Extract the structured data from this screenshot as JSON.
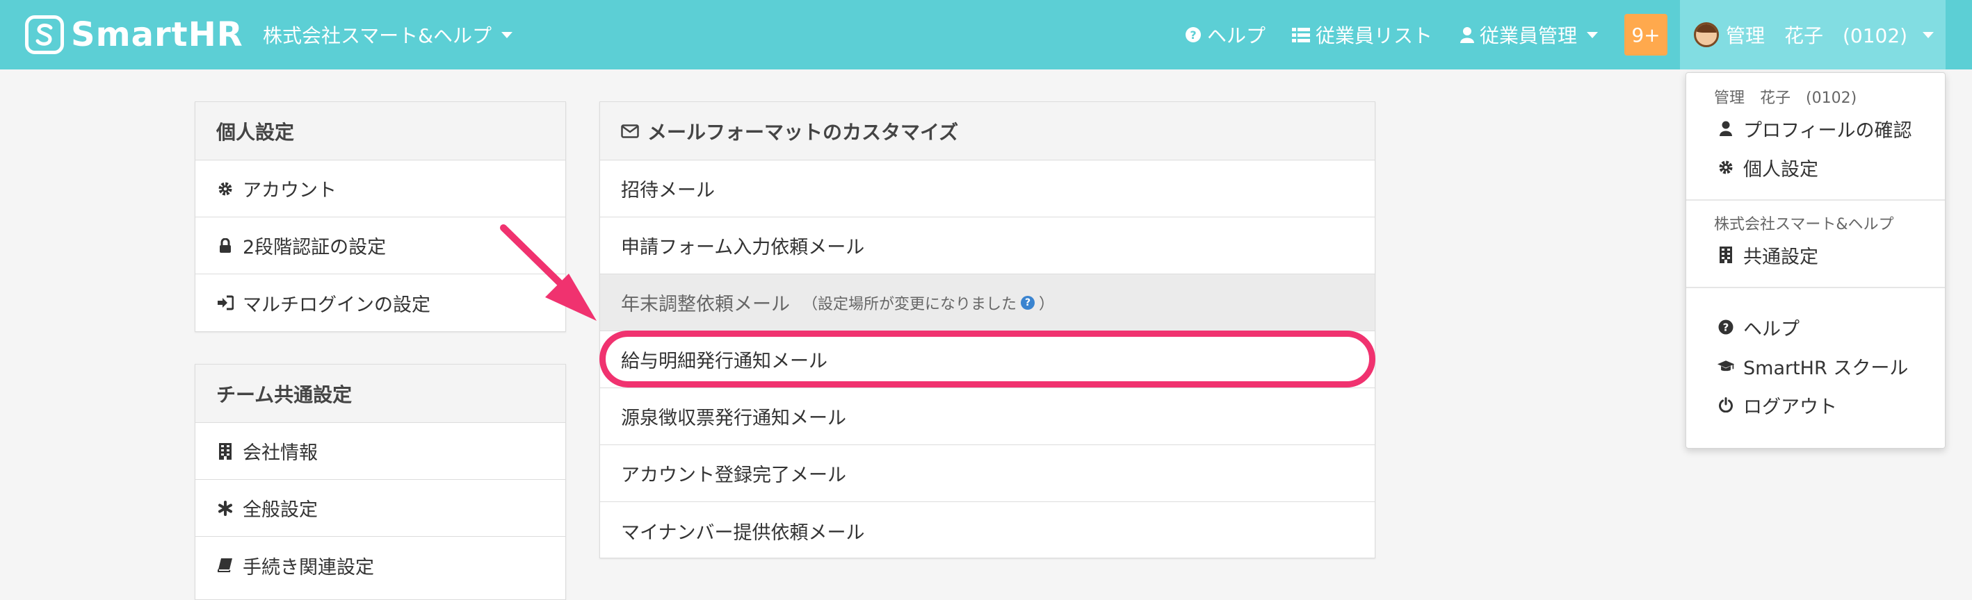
{
  "header": {
    "logo_text": "SmartHR",
    "company_name": "株式会社スマート&ヘルプ",
    "nav": {
      "help": "ヘルプ",
      "employee_list": "従業員リスト",
      "employee_manage": "従業員管理"
    },
    "notification_count": "9+",
    "user_name": "管理　花子　(0102)"
  },
  "personal_settings": {
    "title": "個人設定",
    "items": [
      {
        "label": "アカウント",
        "icon": "gear-icon"
      },
      {
        "label": "2段階認証の設定",
        "icon": "lock-icon"
      },
      {
        "label": "マルチログインの設定",
        "icon": "sign-in-icon"
      }
    ]
  },
  "team_settings": {
    "title": "チーム共通設定",
    "items": [
      {
        "label": "会社情報",
        "icon": "building-icon"
      },
      {
        "label": "全般設定",
        "icon": "asterisk-icon"
      },
      {
        "label": "手続き関連設定",
        "icon": "book-icon"
      }
    ]
  },
  "mail_format": {
    "title": "メールフォーマットのカスタマイズ",
    "items": [
      {
        "label": "招待メール"
      },
      {
        "label": "申請フォーム入力依頼メール"
      },
      {
        "label": "年末調整依頼メール",
        "note": "（設定場所が変更になりました",
        "note_end": "）"
      },
      {
        "label": "給与明細発行通知メール"
      },
      {
        "label": "源泉徴収票発行通知メール"
      },
      {
        "label": "アカウント登録完了メール"
      },
      {
        "label": "マイナンバー提供依頼メール"
      }
    ]
  },
  "user_dropdown": {
    "user_header": "管理　花子　(0102)",
    "user_items": [
      {
        "label": "プロフィールの確認",
        "icon": "user-icon"
      },
      {
        "label": "個人設定",
        "icon": "gear-icon"
      }
    ],
    "company_header": "株式会社スマート&ヘルプ",
    "company_items": [
      {
        "label": "共通設定",
        "icon": "building-icon"
      }
    ],
    "other_items": [
      {
        "label": "ヘルプ",
        "icon": "question-circle-icon"
      },
      {
        "label": "SmartHR スクール",
        "icon": "graduation-cap-icon"
      },
      {
        "label": "ログアウト",
        "icon": "power-icon"
      }
    ]
  },
  "colors": {
    "header_bg": "#5ccfd5",
    "highlight": "#f0326f",
    "badge": "#ffa94d"
  }
}
